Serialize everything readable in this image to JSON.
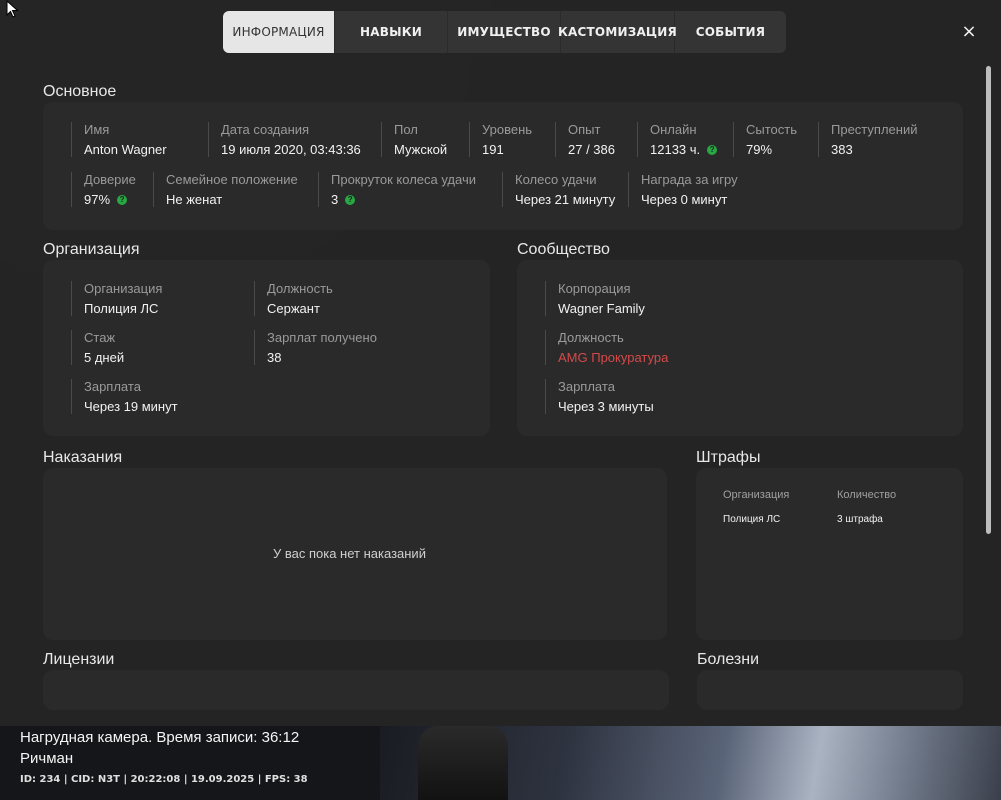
{
  "tabs": [
    "ИНФОРМАЦИЯ",
    "НАВЫКИ",
    "ИМУЩЕСТВО",
    "КАСТОМИЗАЦИЯ",
    "СОБЫТИЯ"
  ],
  "close_symbol": "×",
  "basic": {
    "title": "Основное",
    "row1": [
      {
        "label": "Имя",
        "value": "Anton Wagner"
      },
      {
        "label": "Дата создания",
        "value": "19 июля 2020, 03:43:36"
      },
      {
        "label": "Пол",
        "value": "Мужской"
      },
      {
        "label": "Уровень",
        "value": "191"
      },
      {
        "label": "Опыт",
        "value": "27 / 386"
      },
      {
        "label": "Онлайн",
        "value": "12133 ч."
      },
      {
        "label": "Сытость",
        "value": "79%"
      },
      {
        "label": "Преступлений",
        "value": "383"
      }
    ],
    "row2": [
      {
        "label": "Доверие",
        "value": "97%"
      },
      {
        "label": "Семейное положение",
        "value": "Не женат"
      },
      {
        "label": "Прокруток колеса удачи",
        "value": "3"
      },
      {
        "label": "Колесо удачи",
        "value": "Через 21 минуту"
      },
      {
        "label": "Награда за игру",
        "value": "Через 0 минут"
      }
    ]
  },
  "organization": {
    "title": "Организация",
    "fields": [
      {
        "label": "Организация",
        "value": "Полиция ЛС"
      },
      {
        "label": "Должность",
        "value": "Сержант"
      },
      {
        "label": "Стаж",
        "value": "5 дней"
      },
      {
        "label": "Зарплат получено",
        "value": "38"
      },
      {
        "label": "Зарплата",
        "value": "Через 19 минут"
      }
    ]
  },
  "community": {
    "title": "Сообщество",
    "fields": [
      {
        "label": "Корпорация",
        "value": "Wagner Family"
      },
      {
        "label": "Должность",
        "value": "AMG Прокуратура"
      },
      {
        "label": "Зарплата",
        "value": "Через 3 минуты"
      }
    ]
  },
  "punishments": {
    "title": "Наказания",
    "empty": "У вас пока нет наказаний"
  },
  "fines": {
    "title": "Штрафы",
    "headers": [
      "Организация",
      "Количество"
    ],
    "rows": [
      [
        "Полиция ЛС",
        "3 штрафа"
      ]
    ]
  },
  "licenses": {
    "title": "Лицензии"
  },
  "diseases": {
    "title": "Болезни"
  },
  "colors": {
    "accent_green": "#27a844",
    "accent_red": "#d44a4a",
    "tab_active": "#e6e6e6"
  },
  "hud": {
    "line1": "Нагрудная камера. Время записи: 36:12",
    "line2": "Ричман",
    "line3": "ID: 234 | CID: N3T | 20:22:08 | 19.09.2025 | FPS: 38"
  }
}
